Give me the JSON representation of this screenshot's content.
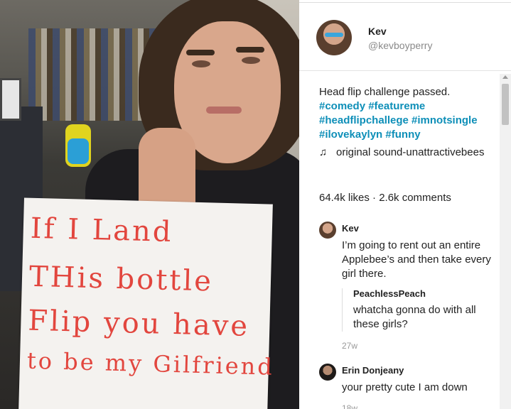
{
  "video": {
    "sign_lines": [
      "If I Land",
      "THis bottle",
      "Flip  you have",
      "to be  my Gilfriend"
    ]
  },
  "author": {
    "name": "Kev",
    "handle": "@kevboyperry"
  },
  "post": {
    "caption": "Head flip challenge passed.",
    "hashtags": [
      "#comedy",
      "#featureme",
      "#headflipchallege",
      "#imnotsingle",
      "#ilovekaylyn",
      "#funny"
    ],
    "sound_icon": "music-note-icon",
    "sound": "original sound-unattractivebees",
    "stats": "64.4k likes · 2.6k comments"
  },
  "comments": [
    {
      "name": "Kev",
      "text": "I’m going to rent out an entire Applebee’s and then take every girl there.",
      "reply": {
        "name": "PeachlessPeach",
        "text": "whatcha gonna do with all these girls?"
      },
      "time": "27w"
    },
    {
      "name": "Erin Donjeany",
      "text": "your pretty cute I am down",
      "time": "18w"
    }
  ],
  "colors": {
    "hashtag": "#0e8fb8",
    "muted": "#8a8a8a",
    "sign_ink": "#e2463e"
  }
}
